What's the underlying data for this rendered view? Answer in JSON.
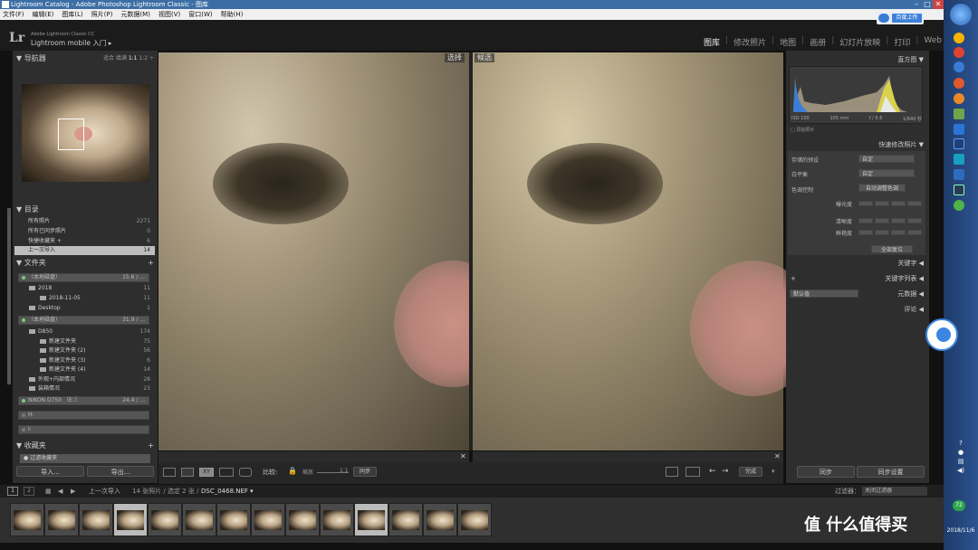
{
  "window": {
    "title": "Lightroom Catalog - Adobe Photoshop Lightroom Classic - 图库"
  },
  "menu": [
    "文件(F)",
    "编辑(E)",
    "图库(L)",
    "照片(P)",
    "元数据(M)",
    "视图(V)",
    "窗口(W)",
    "帮助(H)"
  ],
  "identity": {
    "logo": "Lr",
    "line1": "Adobe Lightroom Classic CC",
    "line2": "Lightroom mobile 入门 ▸"
  },
  "cloud": {
    "button": "百度上传"
  },
  "modules": [
    {
      "label": "图库",
      "active": true
    },
    {
      "label": "修改照片"
    },
    {
      "label": "地图"
    },
    {
      "label": "画册"
    },
    {
      "label": "幻灯片放映"
    },
    {
      "label": "打印"
    },
    {
      "label": "Web"
    }
  ],
  "navigator": {
    "title": "导航器",
    "zoom": [
      "适合",
      "填满",
      "1:1",
      "1:2 ÷"
    ]
  },
  "catalog": {
    "title": "目录",
    "items": [
      {
        "label": "所有照片",
        "count": "2271"
      },
      {
        "label": "所有已同步照片",
        "count": "0"
      },
      {
        "label": "快捷收藏夹 +",
        "count": "6"
      },
      {
        "label": "上一次导入",
        "count": "14"
      }
    ]
  },
  "folders": {
    "title": "文件夹",
    "volumes": [
      {
        "name": "（本地磁盘）",
        "size": "15.6 / ..."
      },
      {
        "name": "（本地磁盘）",
        "size": "31.9 / ..."
      },
      {
        "name": "NIKON D750 （E：）",
        "size": "24.4 / ..."
      },
      {
        "name": "H:",
        "size": ""
      },
      {
        "name": "I:",
        "size": ""
      }
    ],
    "items": [
      {
        "label": "2018",
        "count": "11",
        "indent": 0
      },
      {
        "label": "2018-11-05",
        "count": "11",
        "indent": 1
      },
      {
        "label": "Desktop",
        "count": "1",
        "indent": 0
      },
      {
        "label": "D850",
        "count": "174",
        "indent": 0
      },
      {
        "label": "新建文件夹",
        "count": "75",
        "indent": 1
      },
      {
        "label": "新建文件夹 (2)",
        "count": "56",
        "indent": 1
      },
      {
        "label": "新建文件夹 (3)",
        "count": "6",
        "indent": 1
      },
      {
        "label": "新建文件夹 (4)",
        "count": "14",
        "indent": 1
      },
      {
        "label": "外观+内部情况",
        "count": "28",
        "indent": 0
      },
      {
        "label": "装箱情况",
        "count": "23",
        "indent": 0
      }
    ]
  },
  "collections": {
    "title": "收藏夹",
    "filter": "过滤收藏夹"
  },
  "buttons": {
    "import": "导入...",
    "export": "导出...",
    "sync": "同步",
    "sync_settings": "同步设置",
    "done": "完成"
  },
  "compare": {
    "select_label": "选择",
    "candidate_label": "候选",
    "close": "✕"
  },
  "toolbar": {
    "compare_label": "比较:",
    "zoom_label": "缩放",
    "zoom_value": "1:1",
    "sync_btn": "同步"
  },
  "histogram": {
    "title": "直方图",
    "iso": "ISO 100",
    "focal": "105 mm",
    "aperture": "f / 5.6",
    "shutter": "1/640 秒",
    "original": "原始照片"
  },
  "quick_develop": {
    "title": "快速修改照片",
    "saved_preset_label": "存储的预设",
    "saved_preset_value": "自定",
    "wb_label": "白平衡",
    "wb_value": "自定",
    "tone_label": "色调控制",
    "auto_tone": "自动调整色调",
    "exposure": "曝光度",
    "clarity": "清晰度",
    "vibrance": "鲜艳度",
    "reset": "全部复位"
  },
  "right_sections": [
    "关键字",
    "关键字列表",
    "元数据",
    "评论"
  ],
  "metadata_preset": "默认值",
  "filmstrip": {
    "view1": "1",
    "view2": "2",
    "source": "上一次导入",
    "info": "14 张照片 / 选定 2 张 /",
    "file": "DSC_0468.NEF ▾",
    "filter_label": "过滤器：",
    "filter_value": "关闭过滤器"
  },
  "system": {
    "date": "2018/11/6",
    "badge": "72"
  },
  "watermark": "值 什么值得买"
}
